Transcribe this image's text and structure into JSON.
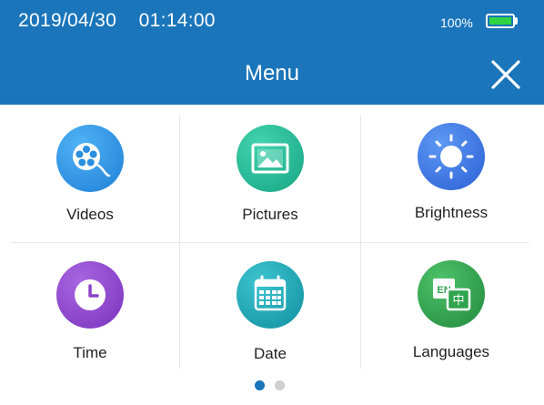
{
  "status": {
    "datetime": "2019/04/30    01:14:00",
    "battery_text": "100%",
    "battery_color": "#2fd344",
    "battery_icon": "battery-full-icon"
  },
  "header": {
    "title": "Menu",
    "close_icon": "close-icon",
    "bar_color": "#1a75ba"
  },
  "menu": {
    "items": [
      {
        "label": "Videos",
        "icon": "film-reel-icon",
        "color": "#2b8fe0"
      },
      {
        "label": "Pictures",
        "icon": "picture-icon",
        "color": "#1fb593"
      },
      {
        "label": "Brightness",
        "icon": "sun-icon",
        "color": "#3472e0"
      },
      {
        "label": "Time",
        "icon": "clock-icon",
        "color": "#8a42c9"
      },
      {
        "label": "Date",
        "icon": "calendar-icon",
        "color": "#18a5b3"
      },
      {
        "label": "Languages",
        "icon": "translate-icon",
        "color": "#2fa34e"
      }
    ]
  },
  "pager": {
    "pages": 2,
    "current": 1,
    "active_color": "#1a75ba",
    "inactive_color": "#cfcfcf"
  }
}
